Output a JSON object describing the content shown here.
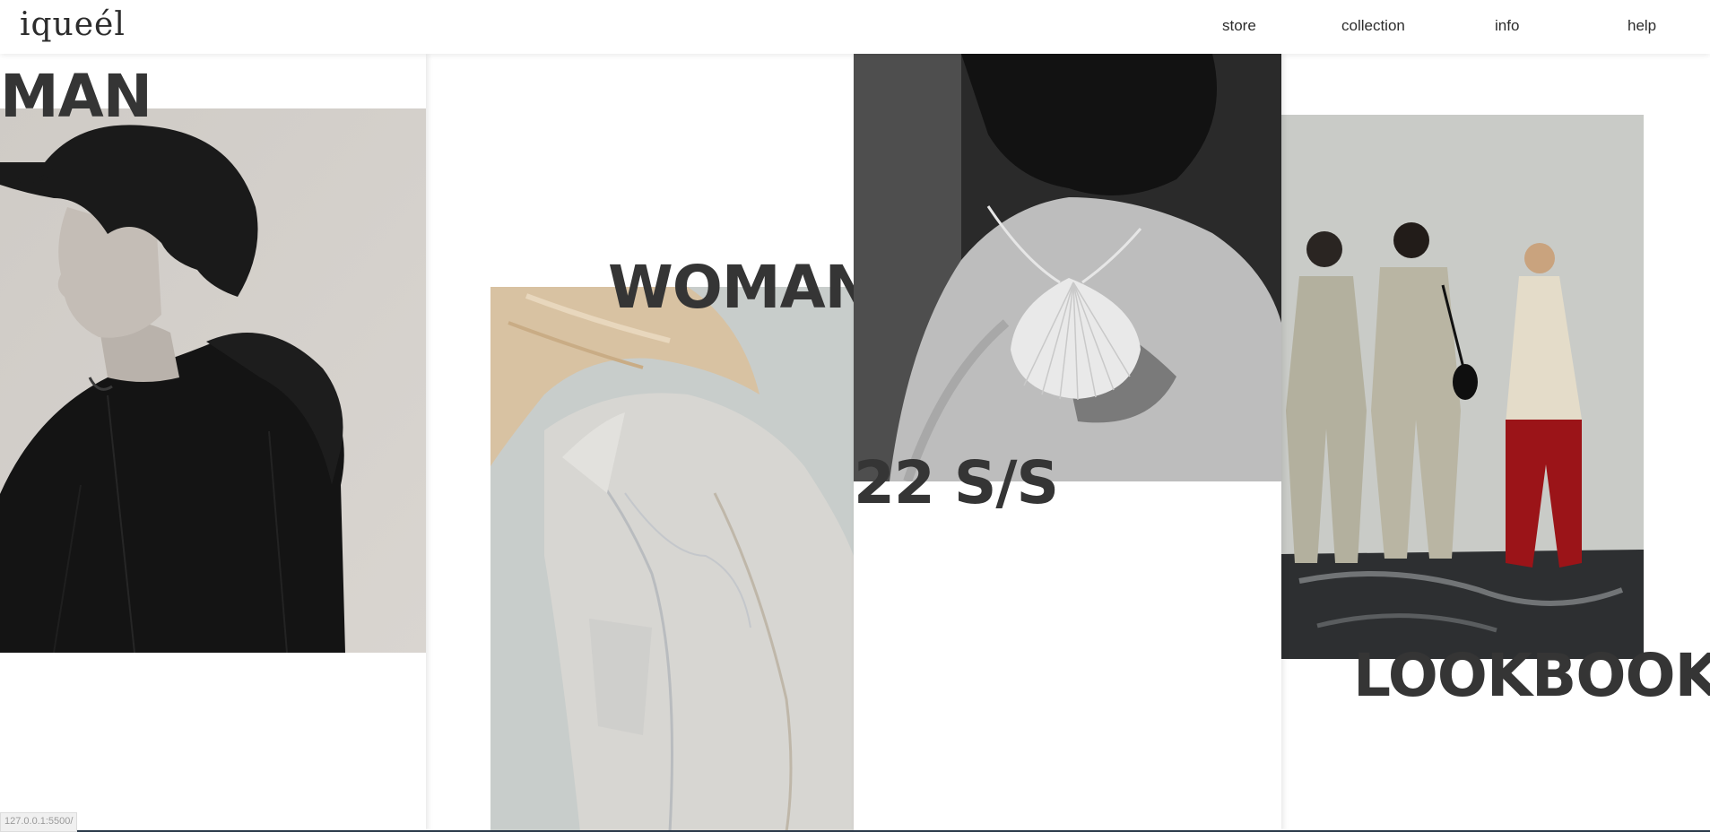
{
  "header": {
    "logo": "iqueél",
    "nav": [
      {
        "label": "store"
      },
      {
        "label": "collection"
      },
      {
        "label": "info"
      },
      {
        "label": "help"
      }
    ]
  },
  "sections": {
    "man": {
      "label": "MAN"
    },
    "woman": {
      "label": "WOMAN"
    },
    "season": {
      "label": "22 S/S"
    },
    "lookbook": {
      "label": "LOOKBOOK"
    }
  },
  "status_bar": {
    "url": "127.0.0.1:5500/"
  }
}
